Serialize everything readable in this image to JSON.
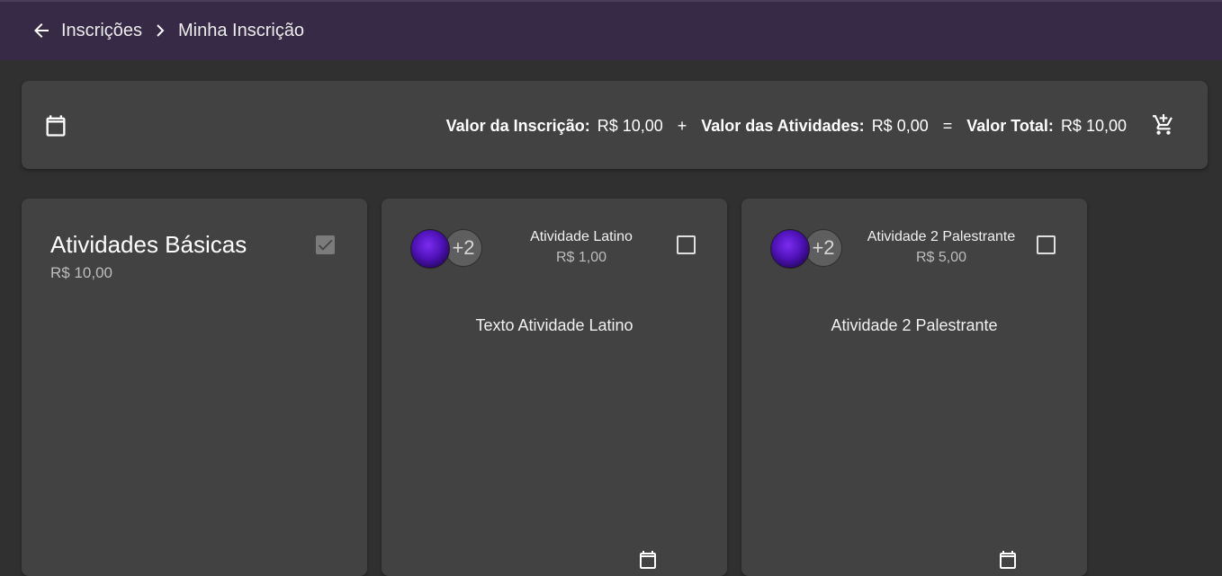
{
  "breadcrumb": {
    "back_icon": "arrow-left-icon",
    "items": [
      "Inscrições",
      "Minha Inscrição"
    ],
    "separator_icon": "chevron-right-icon"
  },
  "summary": {
    "calendar_icon": "calendar-icon",
    "registration_label": "Valor da Inscrição:",
    "registration_value": "R$ 10,00",
    "plus": "+",
    "activities_label": "Valor das Atividades:",
    "activities_value": "R$ 0,00",
    "equals": "=",
    "total_label": "Valor Total:",
    "total_value": "R$ 10,00",
    "cart_icon": "cart-add-icon"
  },
  "cards": [
    {
      "title": "Atividades Básicas",
      "price": "R$ 10,00",
      "checked": true
    },
    {
      "avatar_more": "+2",
      "title": "Atividade Latino",
      "price": "R$ 1,00",
      "text": "Texto Atividade Latino",
      "checked": false
    },
    {
      "avatar_more": "+2",
      "title": "Atividade 2 Palestrante",
      "price": "R$ 5,00",
      "text": "Atividade 2 Palestrante",
      "checked": false
    }
  ],
  "colors": {
    "topbar": "#372a46",
    "background": "#303030",
    "card": "#424242"
  }
}
